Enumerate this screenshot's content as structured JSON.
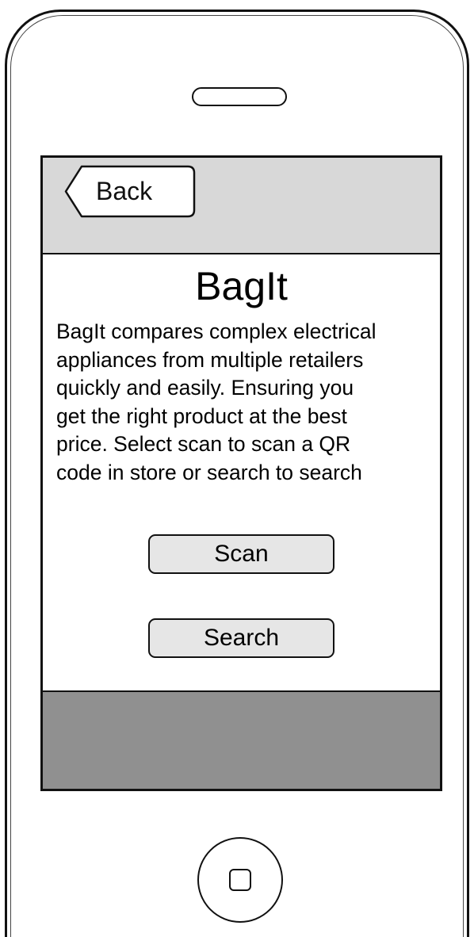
{
  "nav": {
    "back_label": "Back"
  },
  "main": {
    "title": "BagIt",
    "description": "BagIt compares complex electrical\nappliances from multiple retailers\nquickly and easily. Ensuring you\nget the right product at the best\nprice. Select scan to scan a QR\ncode in store or search to search",
    "scan_label": "Scan",
    "search_label": "Search"
  },
  "colors": {
    "nav_bar": "#d8d8d8",
    "tab_bar": "#909090",
    "button_fill": "#e6e6e6",
    "outline": "#111111"
  },
  "icons": {
    "back": "back-arrow-button",
    "home": "home-button-icon",
    "speaker": "speaker-icon"
  }
}
